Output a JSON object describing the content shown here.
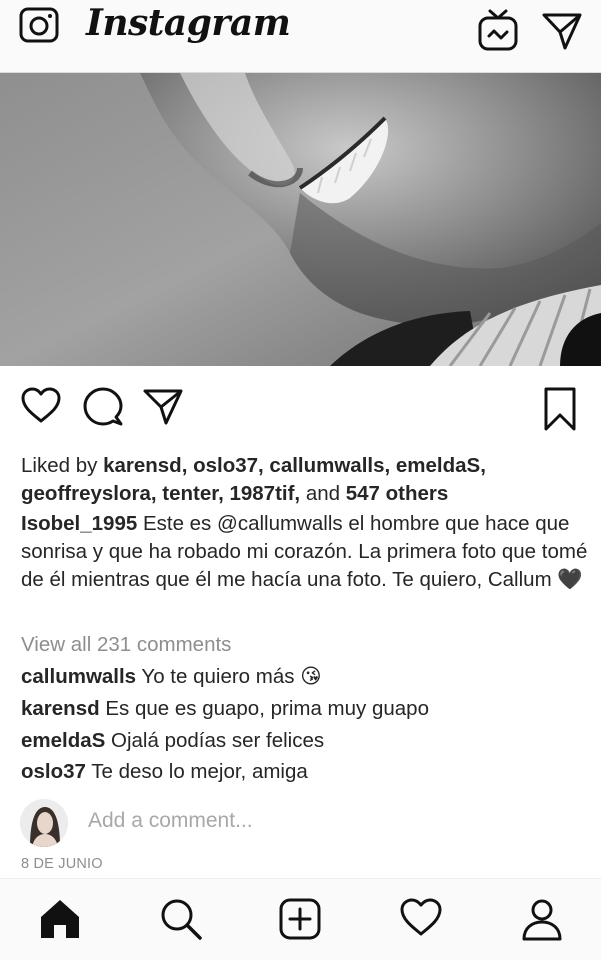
{
  "header": {
    "logo": "Instagram",
    "icons": [
      "camera-icon",
      "igtv-icon",
      "direct-message-icon"
    ]
  },
  "post": {
    "liked_prefix": "Liked by ",
    "liked_names": "karensd, oslo37, callumwalls, emeldaS, geoffreyslora, tenter, 1987tif,",
    "liked_and": " and ",
    "liked_others": "547 others",
    "caption_user": "Isobel_1995",
    "caption_text": " Este es @callumwalls el hombre que hace que sonrisa y que ha robado mi corazón. La primera foto que tomé de él mientras que él me hacía una foto. Te quiero, Callum 🖤",
    "view_all": "View all 231 comments",
    "comments": [
      {
        "user": "callumwalls",
        "text": " Yo te quiero más 😘"
      },
      {
        "user": "karensd",
        "text": " Es que es guapo, prima muy guapo"
      },
      {
        "user": "emeldaS",
        "text": " Ojalá podías ser felices"
      },
      {
        "user": "oslo37",
        "text": " Te deso lo mejor, amiga"
      }
    ],
    "add_comment_placeholder": "Add a comment...",
    "date": "8 DE JUNIO"
  },
  "actions": [
    "heart-icon",
    "comment-icon",
    "share-icon",
    "bookmark-icon"
  ],
  "bottom_nav": [
    "home-icon",
    "search-icon",
    "add-post-icon",
    "activity-heart-icon",
    "profile-icon"
  ]
}
